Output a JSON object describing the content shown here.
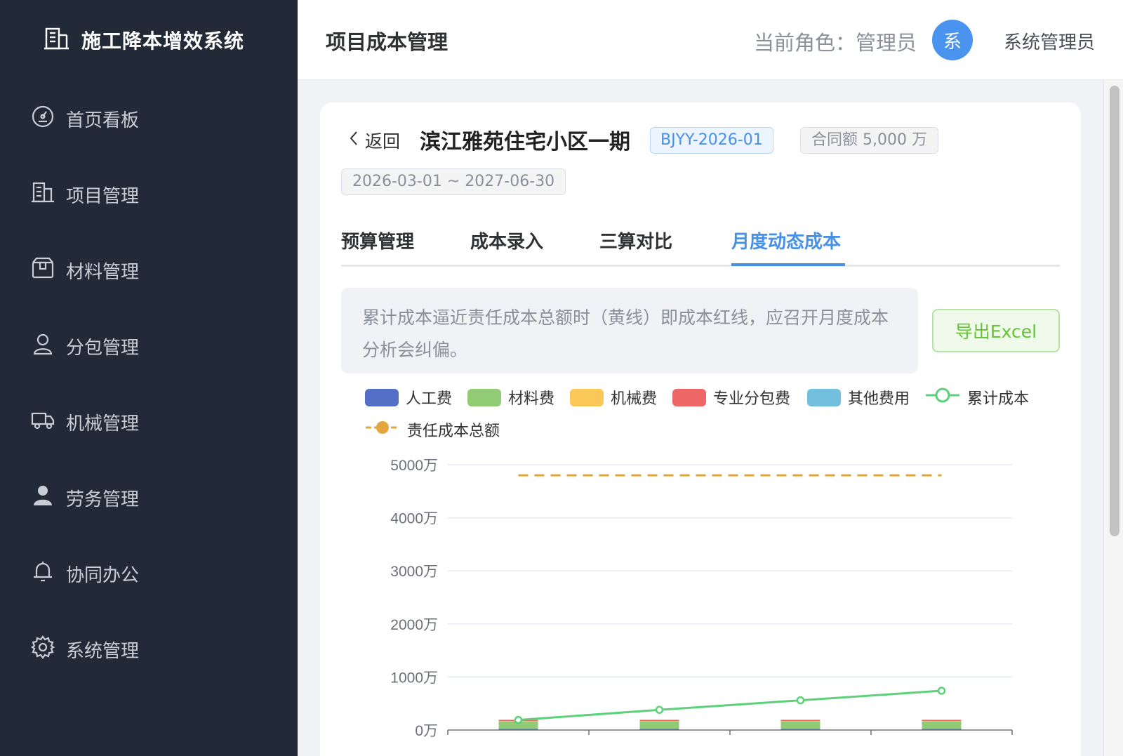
{
  "app": {
    "title": "施工降本增效系统"
  },
  "nav": [
    {
      "label": "首页看板",
      "icon": "dashboard-icon"
    },
    {
      "label": "项目管理",
      "icon": "building-icon"
    },
    {
      "label": "材料管理",
      "icon": "box-icon"
    },
    {
      "label": "分包管理",
      "icon": "user-outline-icon"
    },
    {
      "label": "机械管理",
      "icon": "truck-icon"
    },
    {
      "label": "劳务管理",
      "icon": "user-filled-icon"
    },
    {
      "label": "协同办公",
      "icon": "bell-icon"
    },
    {
      "label": "系统管理",
      "icon": "gear-icon"
    }
  ],
  "header": {
    "page_title": "项目成本管理",
    "role_text": "当前角色：管理员",
    "avatar_char": "系",
    "user_name": "系统管理员"
  },
  "project": {
    "back_label": "返回",
    "name": "滨江雅苑住宅小区一期",
    "code": "BJYY-2026-01",
    "contract": "合同额 5,000 万",
    "period": "2026-03-01 ~ 2027-06-30"
  },
  "tabs": [
    {
      "label": "预算管理",
      "active": false
    },
    {
      "label": "成本录入",
      "active": false
    },
    {
      "label": "三算对比",
      "active": false
    },
    {
      "label": "月度动态成本",
      "active": true
    }
  ],
  "alert_text": "累计成本逼近责任成本总额时（黄线）即成本红线，应召开月度成本分析会纠偏。",
  "export_label": "导出Excel",
  "colors": {
    "labor": "#5470c6",
    "material": "#91cc75",
    "machinery": "#fac858",
    "subcontract": "#ee6666",
    "other": "#73c0de",
    "cumulative": "#5dd07a",
    "budget": "#e3a63f",
    "accent": "#4a90e2",
    "sidebar": "#212a36"
  },
  "chart_data": {
    "type": "bar",
    "ylim": [
      0,
      5000
    ],
    "yticks": [
      "5000万",
      "4000万",
      "3000万",
      "2000万",
      "1000万",
      "0万"
    ],
    "series": [
      {
        "name": "人工费",
        "values": [
          20,
          20,
          20,
          20
        ],
        "stack": true
      },
      {
        "name": "材料费",
        "values": [
          140,
          140,
          140,
          140
        ],
        "stack": true
      },
      {
        "name": "机械费",
        "values": [
          10,
          10,
          10,
          10
        ],
        "stack": true
      },
      {
        "name": "专业分包费",
        "values": [
          20,
          20,
          20,
          20
        ],
        "stack": true
      },
      {
        "name": "其他费用",
        "values": [
          5,
          5,
          5,
          5
        ],
        "stack": true
      },
      {
        "name": "累计成本",
        "type": "line",
        "values": [
          190,
          380,
          560,
          740
        ]
      },
      {
        "name": "责任成本总额",
        "type": "line",
        "dashed": true,
        "values": [
          4800,
          4800,
          4800,
          4800
        ]
      }
    ],
    "legend": "top-left",
    "grid": true
  }
}
